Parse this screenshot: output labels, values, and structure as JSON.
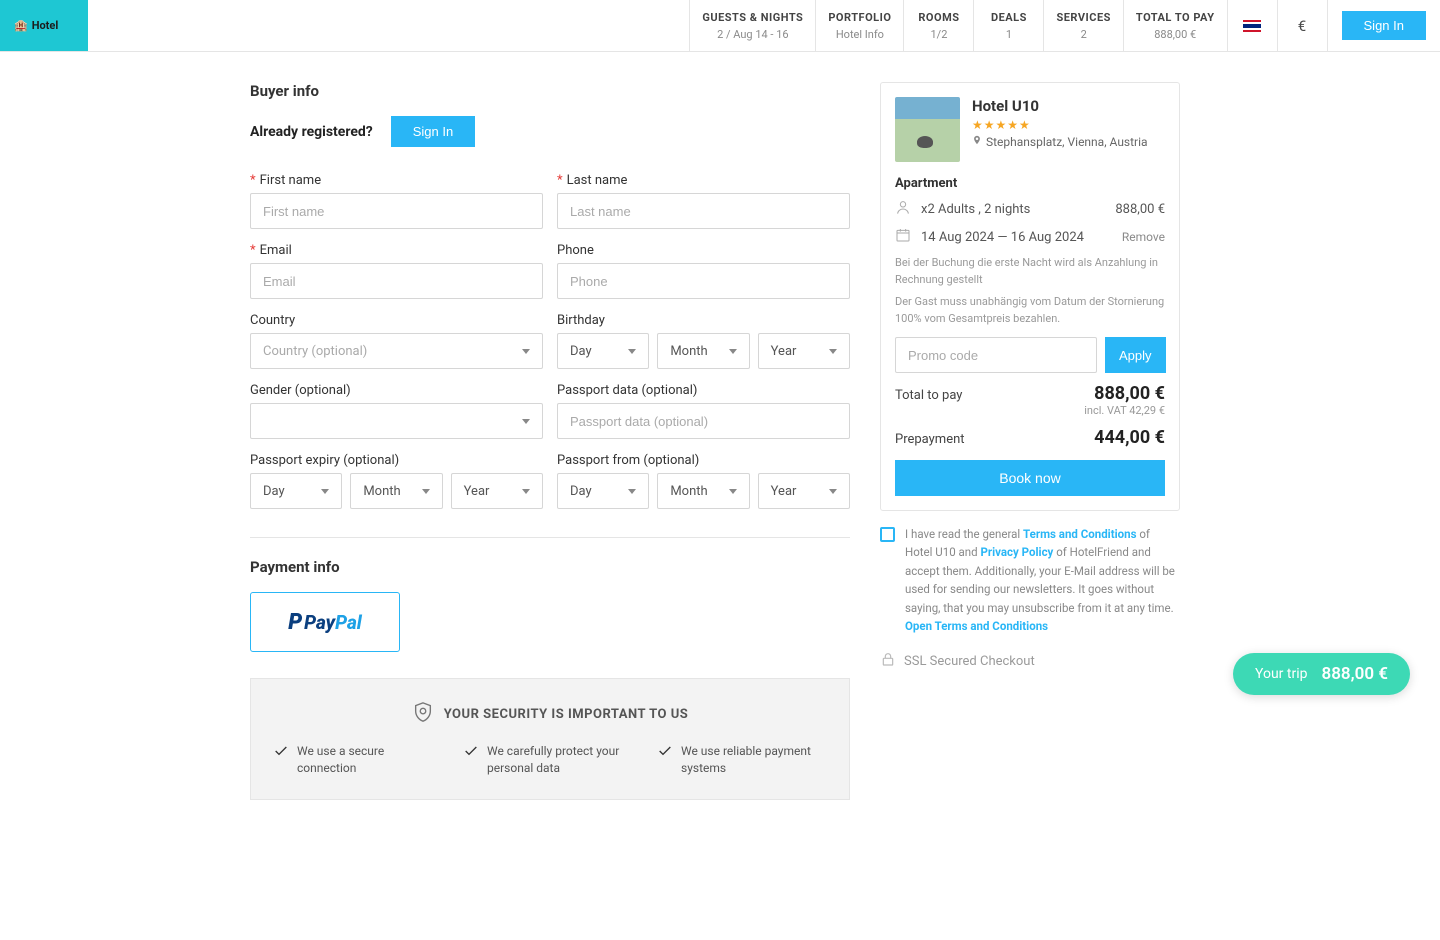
{
  "logo": {
    "text": "Hotel"
  },
  "topnav": {
    "guests_nights": {
      "label": "GUESTS & NIGHTS",
      "value": "2 / Aug 14 - 16"
    },
    "portfolio": {
      "label": "PORTFOLIO",
      "value": "Hotel Info"
    },
    "rooms": {
      "label": "ROOMS",
      "value": "1/2"
    },
    "deals": {
      "label": "DEALS",
      "value": "1"
    },
    "services": {
      "label": "SERVICES",
      "value": "2"
    },
    "total": {
      "label": "TOTAL TO PAY",
      "value": "888,00 €"
    },
    "currency": "€",
    "signin": "Sign In"
  },
  "buyer": {
    "title": "Buyer info",
    "already": "Already registered?",
    "signin_btn": "Sign In",
    "labels": {
      "first_name": "First name",
      "last_name": "Last name",
      "email": "Email",
      "phone": "Phone",
      "country": "Country",
      "birthday": "Birthday",
      "gender": "Gender (optional)",
      "passport_data": "Passport data (optional)",
      "passport_expiry": "Passport expiry (optional)",
      "passport_from": "Passport from (optional)"
    },
    "placeholders": {
      "first_name": "First name",
      "last_name": "Last name",
      "email": "Email",
      "phone": "Phone",
      "country": "Country (optional)",
      "day": "Day",
      "month": "Month",
      "year": "Year",
      "gender_blank": " ",
      "passport_data": "Passport data (optional)"
    }
  },
  "payment": {
    "title": "Payment info",
    "paypal_p1": "Pay",
    "paypal_p2": "Pal"
  },
  "security": {
    "title": "YOUR SECURITY IS IMPORTANT TO US",
    "col1": "We use a secure connection",
    "col2": "We carefully protect your personal data",
    "col3": "We use reliable payment systems"
  },
  "summary": {
    "hotel_name": "Hotel U10",
    "stars": "★★★★★",
    "location": "Stephansplatz, Vienna, Austria",
    "room_type": "Apartment",
    "guests_text": "x2 Adults , 2 nights",
    "guests_price": "888,00 €",
    "dates_text": "14 Aug 2024 — 16 Aug 2024",
    "remove": "Remove",
    "policy1": "Bei der Buchung die erste Nacht wird als Anzahlung in Rechnung gestellt",
    "policy2": "Der Gast muss unabhängig vom Datum der Stornierung 100% vom Gesamtpreis bezahlen.",
    "promo_placeholder": "Promo code",
    "apply": "Apply",
    "total_label": "Total to pay",
    "total_value": "888,00 €",
    "vat": "incl. VAT 42,29 €",
    "prepay_label": "Prepayment",
    "prepay_value": "444,00 €",
    "book": "Book now"
  },
  "terms": {
    "pre": "I have read the general ",
    "tc": "Terms and Conditions",
    "mid1": " of Hotel U10 and ",
    "pp": "Privacy Policy",
    "mid2": " of HotelFriend and accept them. Additionally, your E-Mail address will be used for sending our newsletters. It goes without saying, that you may unsubscribe from it at any time.",
    "open": "Open Terms and Conditions"
  },
  "ssl": "SSL Secured Checkout",
  "pill": {
    "label": "Your trip",
    "price": "888,00 €"
  }
}
